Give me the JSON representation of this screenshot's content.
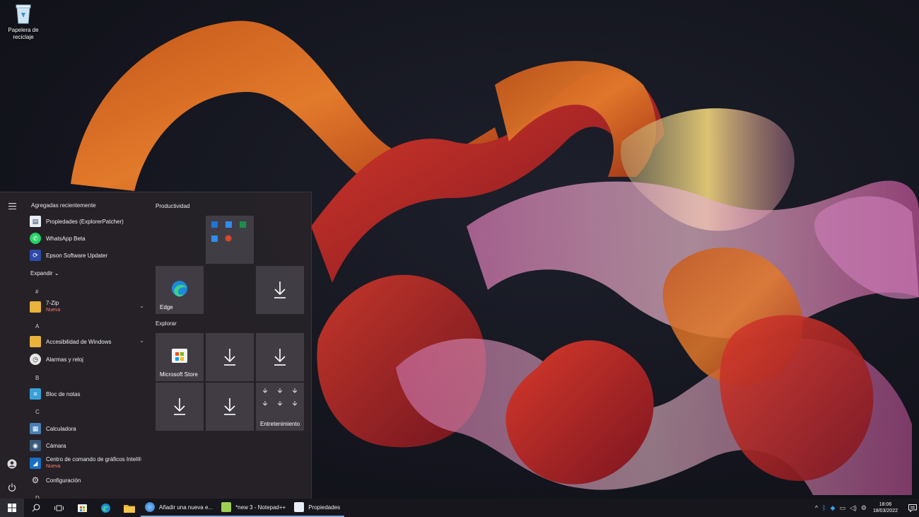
{
  "desktop": {
    "recycle_bin_label": "Papelera de reciclaje"
  },
  "start_menu": {
    "recently_added_header": "Agregadas recientemente",
    "recent_apps": [
      {
        "label": "Propiedades (ExplorerPatcher)",
        "icon": "document-icon"
      },
      {
        "label": "WhatsApp Beta",
        "icon": "whatsapp-icon"
      },
      {
        "label": "Epson Software Updater",
        "icon": "epson-icon"
      }
    ],
    "expand_label": "Expandir",
    "sections": [
      {
        "letter": "#",
        "apps": [
          {
            "label": "7-Zip",
            "sub": "Nueva",
            "icon": "folder-icon",
            "has_chevron": true
          }
        ]
      },
      {
        "letter": "A",
        "apps": [
          {
            "label": "Accesibilidad de Windows",
            "icon": "folder-icon",
            "has_chevron": true
          },
          {
            "label": "Alarmas y reloj",
            "icon": "clock-icon"
          }
        ]
      },
      {
        "letter": "B",
        "apps": [
          {
            "label": "Bloc de notas",
            "icon": "notepad-icon"
          }
        ]
      },
      {
        "letter": "C",
        "apps": [
          {
            "label": "Calculadora",
            "icon": "calculator-icon"
          },
          {
            "label": "Cámara",
            "icon": "camera-icon"
          },
          {
            "label": "Centro de comando de gráficos Intel®",
            "sub": "Nueva",
            "icon": "intel-icon"
          },
          {
            "label": "Configuración",
            "icon": "gear-icon"
          }
        ]
      },
      {
        "letter": "D",
        "apps": []
      }
    ],
    "tile_groups": {
      "productivity_title": "Productividad",
      "explore_title": "Explorar"
    },
    "tiles": {
      "edge_label": "Edge",
      "store_label": "Microsoft Store",
      "entertainment_label": "Entretenimiento"
    }
  },
  "taskbar": {
    "windows": [
      {
        "label": "Añadir una nueva e...",
        "icon": "browser-icon"
      },
      {
        "label": "*new 3 - Notepad++",
        "icon": "notepadpp-icon"
      },
      {
        "label": "Propiedades",
        "icon": "document-icon"
      }
    ],
    "clock_time": "18:06",
    "clock_date": "18/03/2022"
  },
  "colors": {
    "accent": "#7aa6d8",
    "new_badge": "#ff7b6b"
  }
}
